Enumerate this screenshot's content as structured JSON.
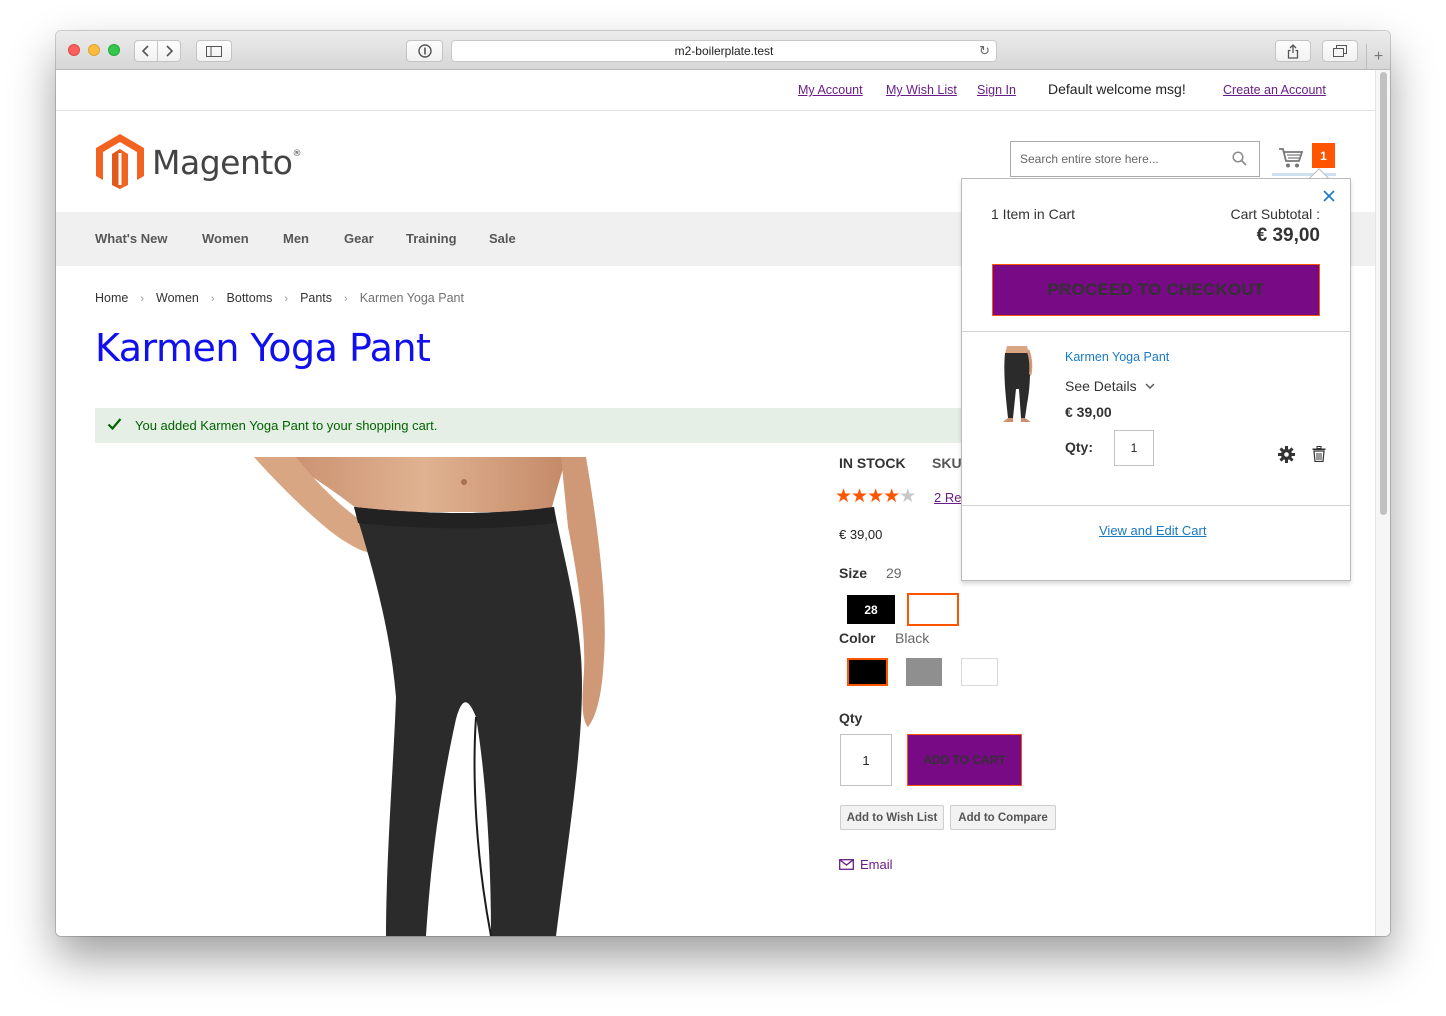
{
  "browser": {
    "url": "m2-boilerplate.test"
  },
  "header": {
    "links": {
      "my_account": "My Account",
      "wish_list": "My Wish List",
      "sign_in": "Sign In",
      "welcome": "Default welcome msg!",
      "create_account": "Create an Account"
    },
    "logo_text": "Magento",
    "logo_mark": "®",
    "search_placeholder": "Search entire store here...",
    "cart_count": "1",
    "brand_color": "#f26322"
  },
  "nav": {
    "items": [
      "What's New",
      "Women",
      "Men",
      "Gear",
      "Training",
      "Sale"
    ]
  },
  "breadcrumbs": [
    "Home",
    "Women",
    "Bottoms",
    "Pants",
    "Karmen Yoga Pant"
  ],
  "breadcrumb_separator": "›",
  "product": {
    "title": "Karmen Yoga Pant",
    "success_message": "You added Karmen Yoga Pant to your shopping cart.",
    "stock": "IN STOCK",
    "sku_label": "SKU",
    "rating": 4,
    "rating_max": 5,
    "reviews": "2 Re",
    "price": "€ 39,00",
    "size_label": "Size",
    "size_selected": "29",
    "sizes": [
      "28",
      ""
    ],
    "color_label": "Color",
    "color_selected": "Black",
    "colors": [
      "#000000",
      "#8f8f8f",
      "#ffffff"
    ],
    "qty_label": "Qty",
    "qty_value": "1",
    "add_to_cart": "ADD TO CART",
    "add_to_wishlist": "Add to Wish List",
    "add_to_compare": "Add to Compare",
    "email": "Email",
    "accent_color": "#780a85",
    "highlight_color": "#ff5501"
  },
  "minicart": {
    "count_text": "1 Item in Cart",
    "subtotal_label": "Cart Subtotal :",
    "subtotal": "€ 39,00",
    "checkout": "PROCEED TO CHECKOUT",
    "item": {
      "name": "Karmen Yoga Pant",
      "see_details": "See Details",
      "price": "€ 39,00",
      "qty_label": "Qty:",
      "qty": "1"
    },
    "view_cart": "View and Edit Cart"
  }
}
